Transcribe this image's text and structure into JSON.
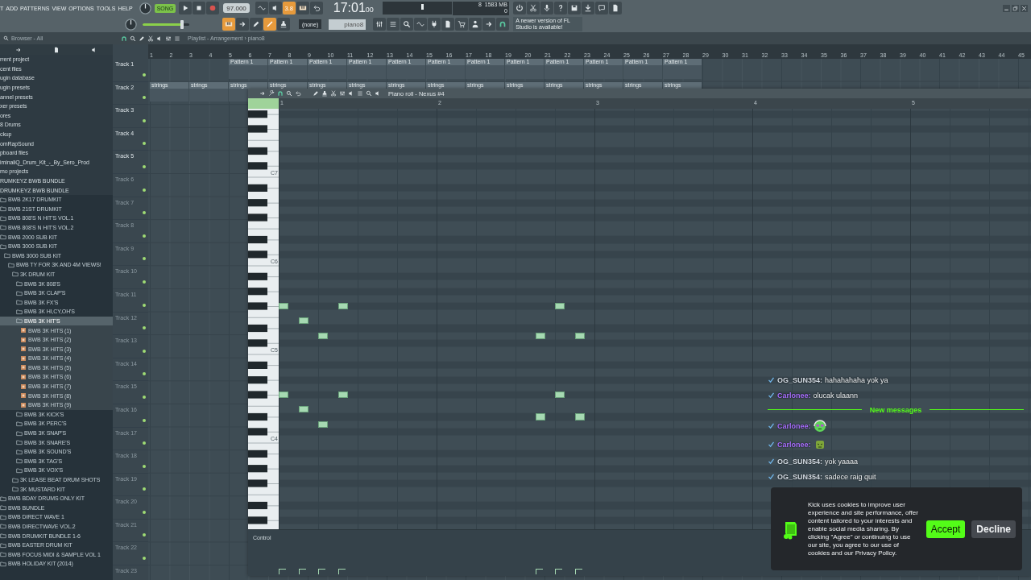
{
  "toolbar": {
    "menu": [
      "T",
      "ADD",
      "PATTERNS",
      "VIEW",
      "OPTIONS",
      "TOOLS",
      "HELP"
    ],
    "song_mode": "SONG",
    "tempo": "97.000",
    "snap_badge": "3.8",
    "time": "17:01",
    "time_small": "00",
    "cpu_value": "8",
    "memory": "1583 MB",
    "polyphony": "0",
    "master_volume": {
      "level": 0.85
    },
    "snap": "(none)",
    "pattern": "piano8",
    "hint": "A newer version of FL Studio is available!"
  },
  "browser": {
    "title": "Browser - All",
    "items": [
      {
        "label": "rrent project",
        "kind": "category",
        "selected": false
      },
      {
        "label": "cent files",
        "kind": "category",
        "selected": false
      },
      {
        "label": "ugin database",
        "kind": "category",
        "selected": false
      },
      {
        "label": "ugin presets",
        "kind": "category",
        "selected": false
      },
      {
        "label": "annel presets",
        "kind": "category",
        "selected": false
      },
      {
        "label": "xer presets",
        "kind": "category",
        "selected": false
      },
      {
        "label": "ores",
        "kind": "category",
        "selected": false
      },
      {
        "label": "8 Drums",
        "kind": "category",
        "selected": false
      },
      {
        "label": "ckup",
        "kind": "category",
        "selected": false
      },
      {
        "label": "omRapSound",
        "kind": "category",
        "selected": false
      },
      {
        "label": "pboard files",
        "kind": "category",
        "selected": false
      },
      {
        "label": "iminaliQ_Drum_Kit_-_By_Sero_Prod",
        "kind": "category",
        "selected": false
      },
      {
        "label": "mo projects",
        "kind": "category",
        "selected": false
      },
      {
        "label": "RUMKEYZ BWB BUNDLE",
        "kind": "category",
        "selected": false
      },
      {
        "label": "DRUMKEYZ BWB BUNDLE",
        "kind": "category",
        "selected": false,
        "children": [
          {
            "label": "BWB 2K17 DRUMKIT",
            "kind": "folder",
            "selected": false
          },
          {
            "label": "BWB 21ST DRUMKIT",
            "kind": "folder",
            "selected": false
          },
          {
            "label": "BWB 808'S N HIT'S VOL.1",
            "kind": "folder",
            "selected": false
          },
          {
            "label": "BWB 808'S N HIT'S VOL.2",
            "kind": "folder",
            "selected": false
          },
          {
            "label": "BWB 2000 SUB KIT",
            "kind": "folder",
            "selected": false
          },
          {
            "label": "BWB 3000 SUB KIT",
            "kind": "folder",
            "selected": false,
            "children": [
              {
                "label": "BWB 3000 SUB KIT",
                "kind": "folder",
                "selected": false,
                "children": [
                  {
                    "label": "BWB TY FOR 3K AND 4M VIEWS!",
                    "kind": "folder",
                    "selected": false,
                    "children": [
                      {
                        "label": "3K DRUM KIT",
                        "kind": "folder",
                        "selected": false,
                        "children": [
                          {
                            "label": "BWB 3K 808'S",
                            "kind": "folder",
                            "selected": false
                          },
                          {
                            "label": "BWB 3K CLAP'S",
                            "kind": "folder",
                            "selected": false
                          },
                          {
                            "label": "BWB 3K FX'S",
                            "kind": "folder",
                            "selected": false
                          },
                          {
                            "label": "BWB 3K HI,CY,OH'S",
                            "kind": "folder",
                            "selected": false
                          },
                          {
                            "label": "BWB 3K HIT'S",
                            "kind": "folder",
                            "selected": true,
                            "children": [
                              {
                                "label": "BWB 3K HITS (1)",
                                "kind": "file",
                                "selected": false
                              },
                              {
                                "label": "BWB 3K HITS (2)",
                                "kind": "file",
                                "selected": false
                              },
                              {
                                "label": "BWB 3K HITS (3)",
                                "kind": "file",
                                "selected": false
                              },
                              {
                                "label": "BWB 3K HITS (4)",
                                "kind": "file",
                                "selected": false
                              },
                              {
                                "label": "BWB 3K HITS (5)",
                                "kind": "file",
                                "selected": false
                              },
                              {
                                "label": "BWB 3K HITS (6)",
                                "kind": "file",
                                "selected": false
                              },
                              {
                                "label": "BWB 3K HITS (7)",
                                "kind": "file",
                                "selected": false
                              },
                              {
                                "label": "BWB 3K HITS (8)",
                                "kind": "file",
                                "selected": false
                              },
                              {
                                "label": "BWB 3K HITS (9)",
                                "kind": "file",
                                "selected": false
                              }
                            ]
                          },
                          {
                            "label": "BWB 3K KICK'S",
                            "kind": "folder",
                            "selected": false
                          },
                          {
                            "label": "BWB 3K PERC'S",
                            "kind": "folder",
                            "selected": false
                          },
                          {
                            "label": "BWB 3K SNAP'S",
                            "kind": "folder",
                            "selected": false
                          },
                          {
                            "label": "BWB 3K SNARE'S",
                            "kind": "folder",
                            "selected": false
                          },
                          {
                            "label": "BWB 3K SOUND'S",
                            "kind": "folder",
                            "selected": false
                          },
                          {
                            "label": "BWB 3K TAG'S",
                            "kind": "folder",
                            "selected": false
                          },
                          {
                            "label": "BWB 3K VOX'S",
                            "kind": "folder",
                            "selected": false
                          }
                        ]
                      },
                      {
                        "label": "3K LEASE BEAT DRUM SHOTS",
                        "kind": "folder",
                        "selected": false
                      },
                      {
                        "label": "3K MUSTARD KIT",
                        "kind": "folder",
                        "selected": false
                      }
                    ]
                  }
                ]
              }
            ]
          },
          {
            "label": "BWB BDAY DRUMS ONLY KIT",
            "kind": "folder",
            "selected": false
          },
          {
            "label": "BWB BUNDLE",
            "kind": "folder",
            "selected": false
          },
          {
            "label": "BWB DIRECT WAVE 1",
            "kind": "folder",
            "selected": false
          },
          {
            "label": "BWB DIRECTWAVE VOL.2",
            "kind": "folder",
            "selected": false
          },
          {
            "label": "BWB DRUMKIT BUNDLE 1-6",
            "kind": "folder",
            "selected": false
          },
          {
            "label": "BWB EASTER DRUM KIT",
            "kind": "folder",
            "selected": false
          },
          {
            "label": "BWB FOCUS MIDI & SAMPLE VOL 1",
            "kind": "folder",
            "selected": false
          },
          {
            "label": "BWB HOLIDAY KIT (2014)",
            "kind": "folder",
            "selected": false
          }
        ]
      }
    ]
  },
  "playlist": {
    "title": "Playlist - Arrangement › piano8",
    "ruler": [
      "1",
      "2",
      "3",
      "4",
      "5",
      "6",
      "7",
      "8",
      "9",
      "10",
      "11",
      "12",
      "13",
      "14",
      "15",
      "16",
      "17",
      "18",
      "19",
      "20",
      "21",
      "22",
      "23",
      "24",
      "25",
      "26",
      "27",
      "28",
      "29",
      "30",
      "31",
      "32",
      "33",
      "34",
      "35",
      "36",
      "37",
      "38",
      "39",
      "40",
      "41",
      "42",
      "43",
      "44",
      "45"
    ],
    "tracks": [
      {
        "label": "Track 1",
        "active": true,
        "clips": [
          {
            "kind": "empty"
          },
          {
            "kind": "empty"
          },
          {
            "kind": "pattern",
            "label": "Pattern 1"
          },
          {
            "kind": "pattern",
            "label": "Pattern 1"
          },
          {
            "kind": "pattern",
            "label": "Pattern 1"
          },
          {
            "kind": "pattern",
            "label": "Pattern 1"
          },
          {
            "kind": "pattern",
            "label": "Pattern 1"
          },
          {
            "kind": "pattern",
            "label": "Pattern 1"
          },
          {
            "kind": "pattern",
            "label": "Pattern 1"
          },
          {
            "kind": "pattern",
            "label": "Pattern 1"
          },
          {
            "kind": "pattern",
            "label": "Pattern 1"
          },
          {
            "kind": "pattern",
            "label": "Pattern 1"
          },
          {
            "kind": "pattern",
            "label": "Pattern 1"
          },
          {
            "kind": "pattern",
            "label": "Pattern 1"
          }
        ]
      },
      {
        "label": "Track 2",
        "active": true,
        "clips": [
          {
            "kind": "pattern",
            "label": "strings"
          },
          {
            "kind": "pattern",
            "label": "strings"
          },
          {
            "kind": "pattern",
            "label": "strings"
          },
          {
            "kind": "pattern",
            "label": "strings"
          },
          {
            "kind": "pattern",
            "label": "strings"
          },
          {
            "kind": "pattern",
            "label": "strings"
          },
          {
            "kind": "pattern",
            "label": "strings"
          },
          {
            "kind": "pattern",
            "label": "strings"
          },
          {
            "kind": "pattern",
            "label": "strings"
          },
          {
            "kind": "pattern",
            "label": "strings"
          },
          {
            "kind": "pattern",
            "label": "strings"
          },
          {
            "kind": "pattern",
            "label": "strings"
          },
          {
            "kind": "pattern",
            "label": "strings"
          },
          {
            "kind": "pattern",
            "label": "strings"
          }
        ]
      },
      {
        "label": "Track 3",
        "active": true
      },
      {
        "label": "Track 4",
        "active": true
      },
      {
        "label": "Track 5",
        "active": true
      },
      {
        "label": "Track 6",
        "active": false
      },
      {
        "label": "Track 7",
        "active": false
      },
      {
        "label": "Track 8",
        "active": false
      },
      {
        "label": "Track 9",
        "active": false
      },
      {
        "label": "Track 10",
        "active": false
      },
      {
        "label": "Track 11",
        "active": false
      },
      {
        "label": "Track 12",
        "active": false
      },
      {
        "label": "Track 13",
        "active": false
      },
      {
        "label": "Track 14",
        "active": false
      },
      {
        "label": "Track 15",
        "active": false
      },
      {
        "label": "Track 16",
        "active": false
      },
      {
        "label": "Track 17",
        "active": false
      },
      {
        "label": "Track 18",
        "active": false
      },
      {
        "label": "Track 19",
        "active": false
      },
      {
        "label": "Track 20",
        "active": false
      },
      {
        "label": "Track 21",
        "active": false
      },
      {
        "label": "Track 22",
        "active": false
      },
      {
        "label": "Track 23",
        "active": false
      }
    ]
  },
  "piano_roll": {
    "title": "Piano roll - Nexus #4",
    "bars": [
      "1",
      "2",
      "3",
      "4",
      "5"
    ],
    "octave_labels": [
      "C7",
      "C6",
      "C5",
      "C4"
    ],
    "control_label": "Control"
  },
  "chat": {
    "messages": [
      {
        "kind": "text",
        "user": "OG_SUN354:",
        "color": "#d5dde5",
        "text": "hahahahaha yok ya"
      },
      {
        "kind": "text",
        "user": "Carlonee:",
        "color": "#a970ff",
        "text": "olucak ulaann"
      },
      {
        "kind": "divider",
        "text": "New messages"
      },
      {
        "kind": "emote",
        "user": "Carlonee:",
        "color": "#a970ff"
      },
      {
        "kind": "sticker",
        "user": "Carlonee:",
        "color": "#a970ff"
      },
      {
        "kind": "text",
        "user": "OG_SUN354:",
        "color": "#d5dde5",
        "text": "yok yaaaa"
      },
      {
        "kind": "text",
        "user": "OG_SUN354:",
        "color": "#d5dde5",
        "text": "sadece raig quit"
      }
    ]
  },
  "cookie_banner": {
    "text": "Kick uses cookies to improve user experience and site performance, offer content tailored to your interests and enable social media sharing. By clicking \"Agree\" or continuing to use our site, you agree to our use of cookies and our Privacy Policy.",
    "buttons": [
      {
        "label": "Accept",
        "kind": "accept"
      },
      {
        "label": "Decline",
        "kind": "decline"
      }
    ]
  }
}
